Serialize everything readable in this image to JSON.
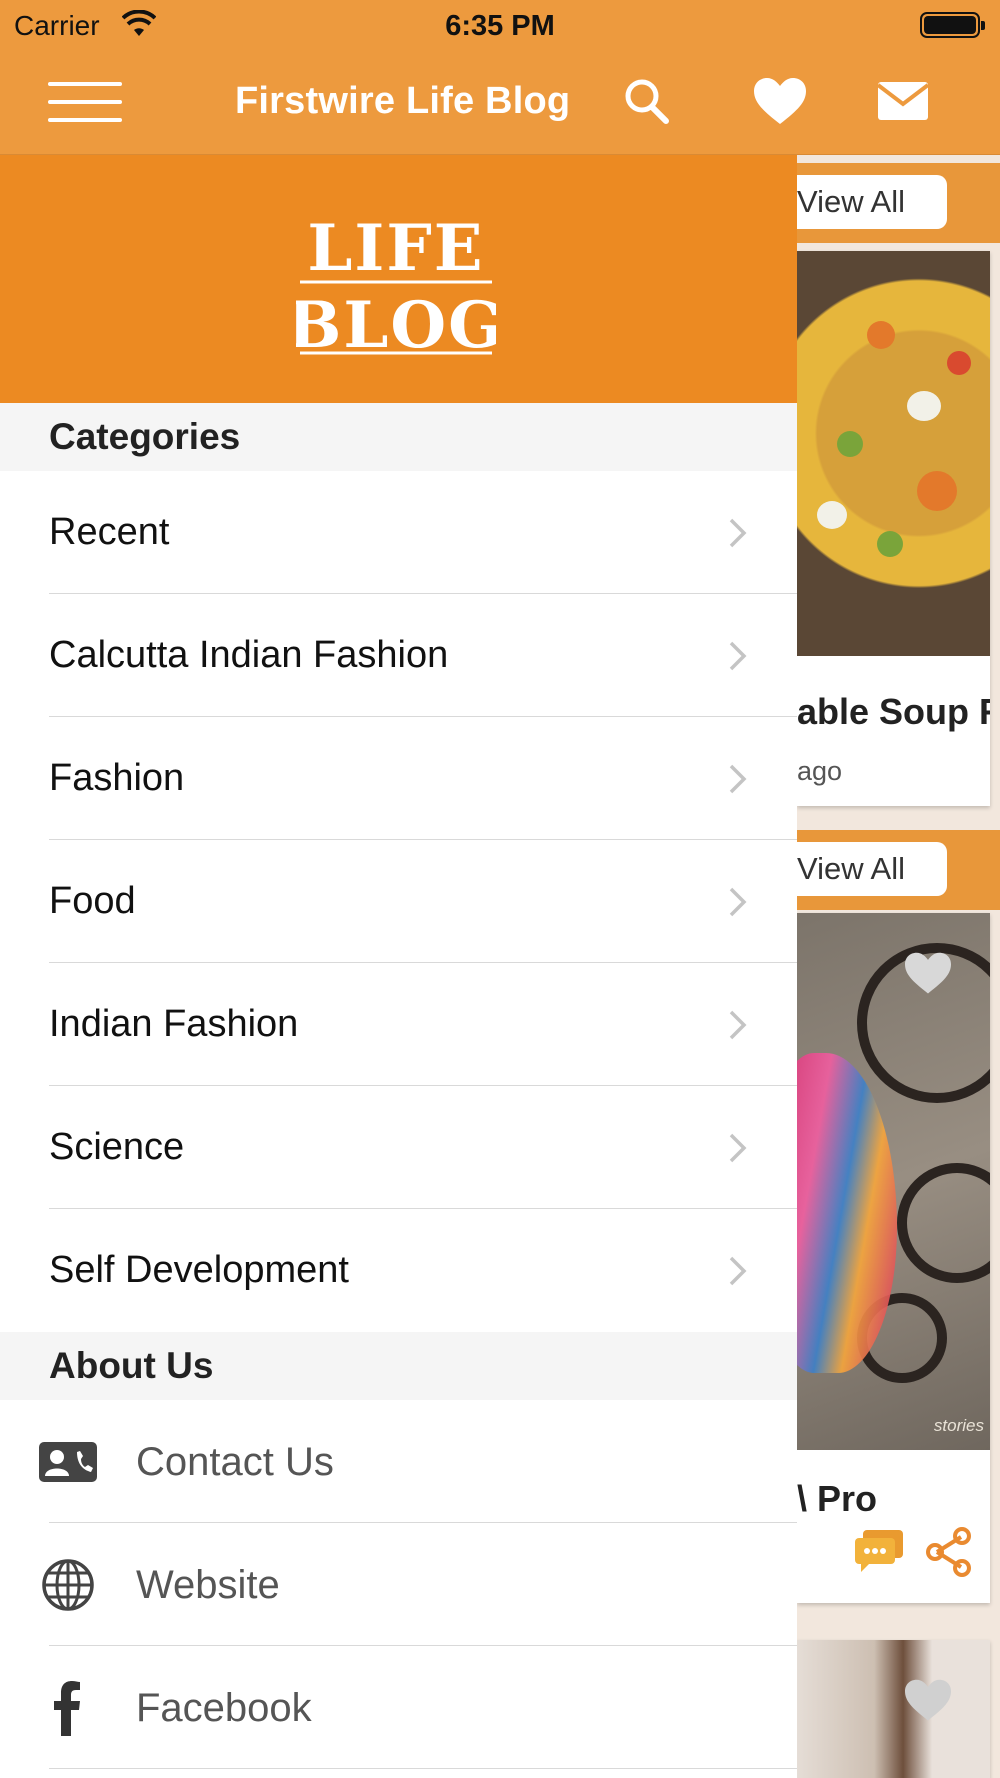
{
  "status_bar": {
    "carrier": "Carrier",
    "time": "6:35 PM"
  },
  "navbar": {
    "title": "Firstwire Life Blog",
    "icons": [
      "menu-icon",
      "search-icon",
      "heart-icon",
      "mail-icon"
    ]
  },
  "drawer": {
    "logo_line1": "LIFE",
    "logo_line2": "BLOG",
    "categories_header": "Categories",
    "categories": [
      {
        "label": "Recent"
      },
      {
        "label": "Calcutta Indian Fashion"
      },
      {
        "label": "Fashion"
      },
      {
        "label": "Food"
      },
      {
        "label": "Indian Fashion"
      },
      {
        "label": "Science"
      },
      {
        "label": "Self Development"
      }
    ],
    "about_header": "About Us",
    "about_items": [
      {
        "label": "Contact Us",
        "icon": "contact-card-icon"
      },
      {
        "label": "Website",
        "icon": "globe-icon"
      },
      {
        "label": "Facebook",
        "icon": "facebook-icon"
      }
    ]
  },
  "background": {
    "section1_view_all": "View All",
    "card1_title": "able Soup R",
    "card1_sub": "ago",
    "section2_view_all": "View All",
    "card2_title": "\\ Pro",
    "card2_watermark": "stories"
  },
  "colors": {
    "accent": "#ED9A3E",
    "drawer_header": "#EC8A22",
    "text": "#111111"
  }
}
